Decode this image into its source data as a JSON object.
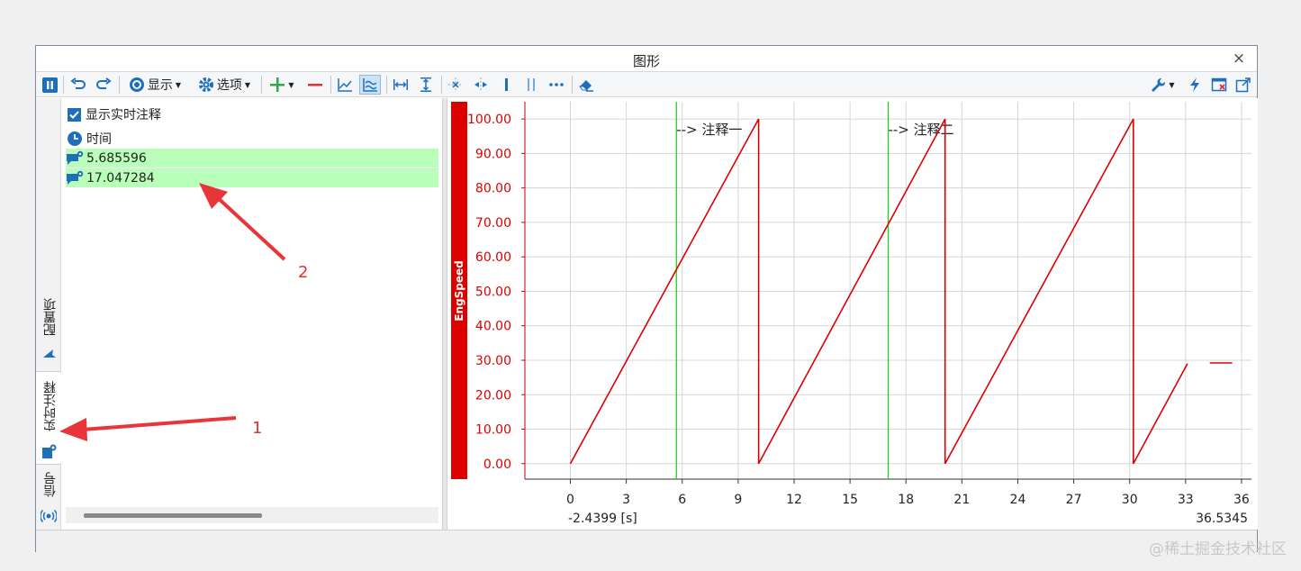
{
  "window": {
    "title": "图形",
    "close_glyph": "×"
  },
  "toolbar": {
    "display_label": "显示",
    "options_label": "选项",
    "icons": [
      "pause-icon",
      "undo-icon",
      "redo-icon",
      "display-icon",
      "gear-icon",
      "add-icon",
      "remove-icon",
      "line-chart-icon",
      "multi-line-icon",
      "fit-horizontal-icon",
      "fit-vertical-icon",
      "cursor-cross-icon",
      "cursor-split-icon",
      "single-cursor-icon",
      "double-cursor-icon",
      "more-icon",
      "eraser-icon",
      "wrench-icon",
      "lightning-icon",
      "close-window-icon",
      "export-icon"
    ]
  },
  "vtabs": [
    {
      "label": "配置项",
      "icon": "config-icon"
    },
    {
      "label": "实时注释",
      "icon": "annotation-icon",
      "active": true
    },
    {
      "label": "信号",
      "icon": "signal-icon"
    }
  ],
  "annotations_panel": {
    "show_realtime_label": "显示实时注释",
    "checked": true,
    "time_header": "时间",
    "items": [
      "5.685596",
      "17.047284"
    ]
  },
  "callouts": {
    "one": "1",
    "two": "2"
  },
  "watermark": "@稀土掘金技术社区",
  "colors": {
    "signal": "#dd0000",
    "annotation_line": "#22cc22",
    "highlight": "#b9ffb9",
    "accent": "#1e6fba"
  },
  "chart_data": {
    "type": "line",
    "series": [
      {
        "name": "EngSpeed",
        "color": "#dd0000"
      }
    ],
    "x_ticks": [
      "0",
      "3",
      "6",
      "9",
      "12",
      "15",
      "18",
      "21",
      "24",
      "27",
      "30",
      "33",
      "36"
    ],
    "y_ticks": [
      "0.00",
      "10.00",
      "20.00",
      "30.00",
      "40.00",
      "50.00",
      "60.00",
      "70.00",
      "80.00",
      "90.00",
      "100.00"
    ],
    "xlim": [
      -2.4399,
      36.5345
    ],
    "ylim": [
      -4.5,
      105
    ],
    "x_min_label": "-2.4399 [s]",
    "x_max_label": "36.5345",
    "points": [
      [
        0,
        0
      ],
      [
        10.1,
        100
      ],
      [
        10.1,
        0
      ],
      [
        20.1,
        100
      ],
      [
        20.1,
        0
      ],
      [
        30.2,
        100
      ],
      [
        30.2,
        0
      ],
      [
        33.1,
        29
      ],
      [
        null,
        null
      ],
      [
        34.3,
        29.2
      ],
      [
        35.5,
        29.2
      ]
    ],
    "annotations": [
      {
        "x": 5.685596,
        "label": "--> 注释一"
      },
      {
        "x": 17.047284,
        "label": "--> 注释二"
      }
    ]
  }
}
